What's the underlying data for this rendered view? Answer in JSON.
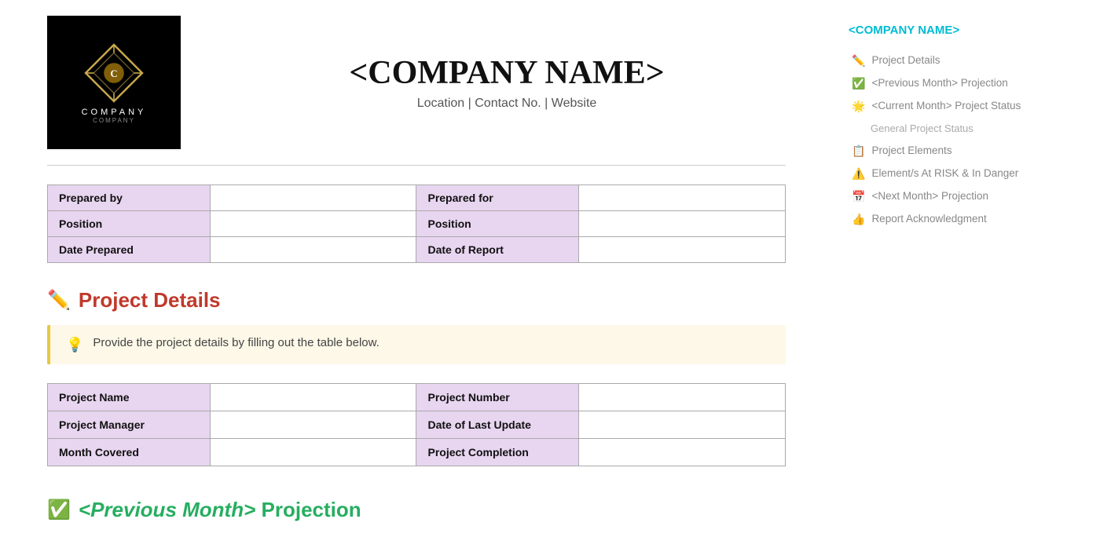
{
  "header": {
    "company_name": "<COMPANY NAME>",
    "company_subtitle": "Location | Contact No. | Website",
    "logo_company": "COMPANY",
    "logo_sub": "COMPANY"
  },
  "prepared_table": {
    "rows": [
      {
        "label1": "Prepared by",
        "value1": "",
        "label2": "Prepared for",
        "value2": ""
      },
      {
        "label1": "Position",
        "value1": "",
        "label2": "Position",
        "value2": ""
      },
      {
        "label1": "Date Prepared",
        "value1": "",
        "label2": "Date of Report",
        "value2": ""
      }
    ]
  },
  "project_details": {
    "icon": "✏️",
    "title": "Project Details",
    "hint": "Provide the project details by filling out the table below.",
    "hint_icon": "💡",
    "rows": [
      {
        "label1": "Project Name",
        "value1": "",
        "label2": "Project Number",
        "value2": ""
      },
      {
        "label1": "Project Manager",
        "value1": "",
        "label2": "Date of Last Update",
        "value2": ""
      },
      {
        "label1": "Month Covered",
        "value1": "",
        "label2": "Project Completion",
        "value2": ""
      }
    ]
  },
  "prev_month": {
    "icon": "✅",
    "label_italic": "<Previous Month>",
    "label_rest": " Projection"
  },
  "sidebar": {
    "company_name": "<COMPANY NAME>",
    "nav_items": [
      {
        "icon": "✏️",
        "label": "Project Details",
        "sub": false
      },
      {
        "icon": "✅",
        "label": "<Previous Month> Projection",
        "sub": false
      },
      {
        "icon": "🌟",
        "label": "<Current Month> Project Status",
        "sub": false
      },
      {
        "icon": "",
        "label": "General Project Status",
        "sub": true
      },
      {
        "icon": "📋",
        "label": "Project Elements",
        "sub": false
      },
      {
        "icon": "⚠️",
        "label": "Element/s At RISK & In Danger",
        "sub": false
      },
      {
        "icon": "📅",
        "label": "<Next Month> Projection",
        "sub": false
      },
      {
        "icon": "👍",
        "label": "Report Acknowledgment",
        "sub": false
      }
    ]
  }
}
